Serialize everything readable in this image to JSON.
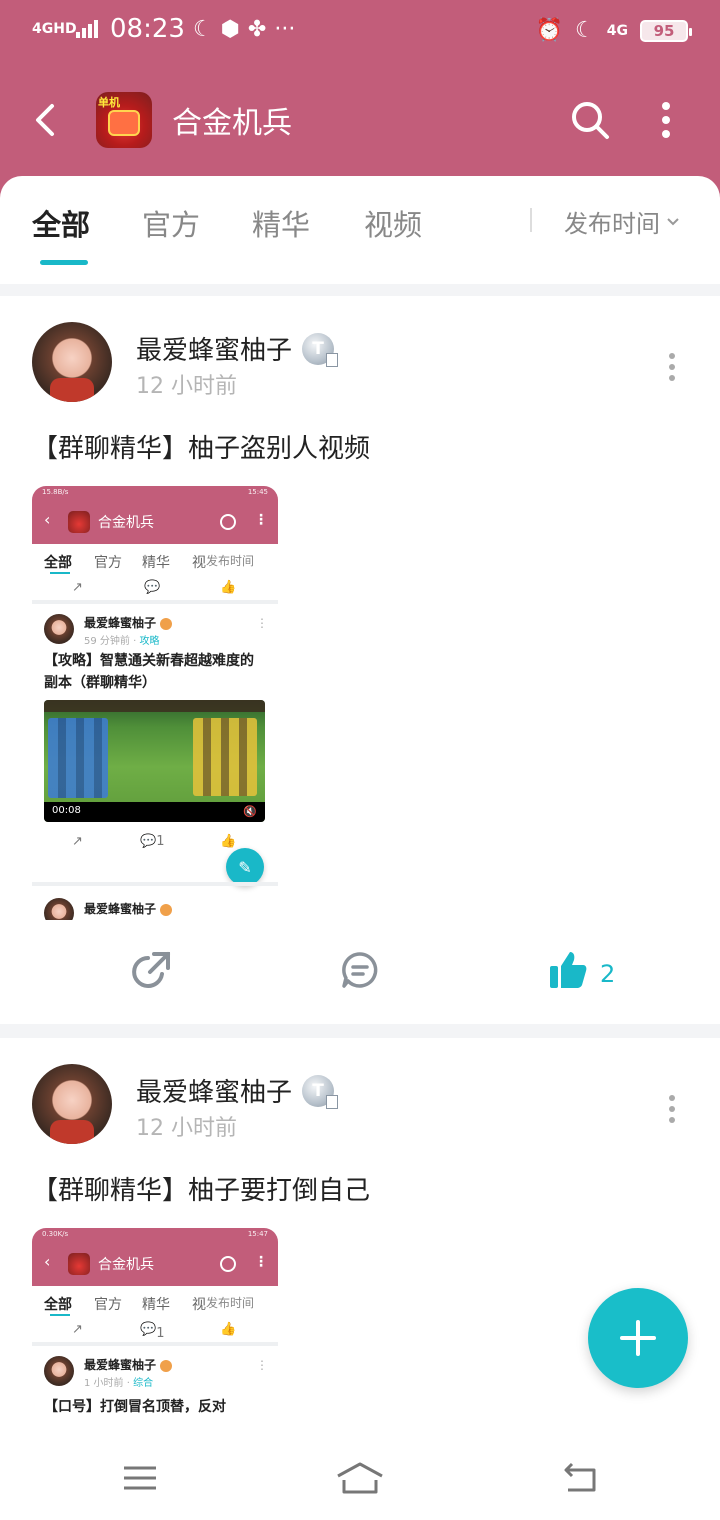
{
  "status_bar": {
    "network": "4GHD",
    "time": "08:23",
    "right_network": "4G",
    "battery": "95"
  },
  "navbar": {
    "title": "合金机兵",
    "icon_badge": "单机"
  },
  "tabs": [
    {
      "label": "全部",
      "active": true
    },
    {
      "label": "官方"
    },
    {
      "label": "精华"
    },
    {
      "label": "视频"
    }
  ],
  "sort": {
    "label": "发布时间"
  },
  "posts": [
    {
      "author": "最爱蜂蜜柚子",
      "badge": "T",
      "time": "12 小时前",
      "title": "【群聊精华】柚子盗别人视频",
      "like_count": "2",
      "screenshot": {
        "status": "15.8B/s",
        "status_right": "15:45",
        "nav_title": "合金机兵",
        "tabs": [
          "全部",
          "官方",
          "精华",
          "视",
          "发布时间"
        ],
        "post1": {
          "author": "最爱蜂蜜柚子",
          "time": "59 分钟前",
          "tag": "攻略",
          "title": "【攻略】智慧通关新春超越难度的副本（群聊精华）",
          "video_time": "00:08",
          "comment_count": "1"
        },
        "post2": {
          "author": "最爱蜂蜜柚子"
        }
      }
    },
    {
      "author": "最爱蜂蜜柚子",
      "badge": "T",
      "time": "12 小时前",
      "title": "【群聊精华】柚子要打倒自己",
      "screenshot": {
        "status": "0.30K/s",
        "status_right": "15:47",
        "nav_title": "合金机兵",
        "tabs": [
          "全部",
          "官方",
          "精华",
          "视",
          "发布时间"
        ],
        "comment_count": "1",
        "post1": {
          "author": "最爱蜂蜜柚子",
          "time": "1 小时前",
          "tag": "综合",
          "title": "【口号】打倒冒名顶替，反对"
        }
      }
    }
  ],
  "colors": {
    "header": "#c25d7a",
    "accent": "#19b8c8"
  }
}
